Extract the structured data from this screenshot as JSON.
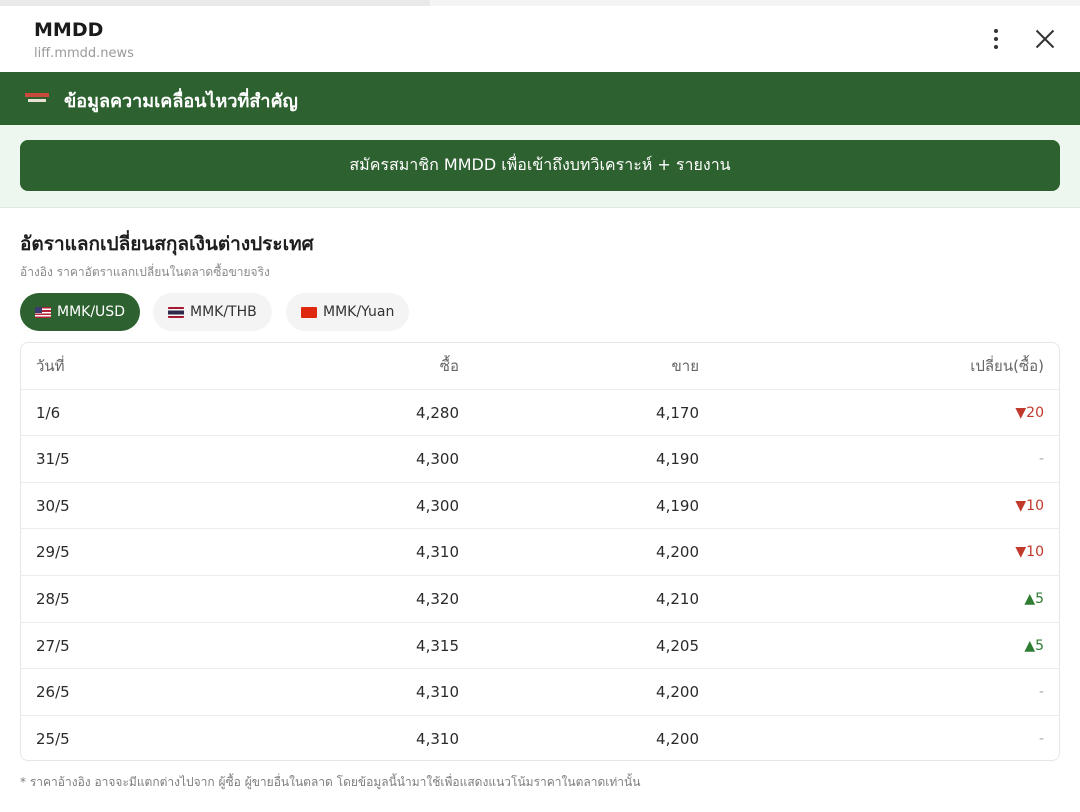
{
  "header": {
    "title": "MMDD",
    "url": "liff.mmdd.news"
  },
  "banner": {
    "title": "ข้อมูลความเคลื่อนไหวที่สำคัญ"
  },
  "promo": {
    "label": "สมัครสมาชิก MMDD เพื่อเข้าถึงบทวิเคราะห์ + รายงาน"
  },
  "section": {
    "title": "อัตราแลกเปลี่ยนสกุลเงินต่างประเทศ",
    "subtitle": "อ้างอิง ราคาอัตราแลกเปลี่ยนในตลาดซื้อขายจริง"
  },
  "tabs": [
    {
      "label": "MMK/USD",
      "flag": "us-flag-icon",
      "active": true
    },
    {
      "label": "MMK/THB",
      "flag": "thai-flag-icon",
      "active": false
    },
    {
      "label": "MMK/Yuan",
      "flag": "china-flag-icon",
      "active": false
    }
  ],
  "table": {
    "headers": {
      "date": "วันที่",
      "buy": "ซื้อ",
      "sell": "ขาย",
      "change": "เปลี่ยน(ซื้อ)"
    },
    "rows": [
      {
        "date": "1/6",
        "buy": "4,280",
        "sell": "4,170",
        "change": "▼20",
        "dir": "down"
      },
      {
        "date": "31/5",
        "buy": "4,300",
        "sell": "4,190",
        "change": "-",
        "dir": "flat"
      },
      {
        "date": "30/5",
        "buy": "4,300",
        "sell": "4,190",
        "change": "▼10",
        "dir": "down"
      },
      {
        "date": "29/5",
        "buy": "4,310",
        "sell": "4,200",
        "change": "▼10",
        "dir": "down"
      },
      {
        "date": "28/5",
        "buy": "4,320",
        "sell": "4,210",
        "change": "▲5",
        "dir": "up"
      },
      {
        "date": "27/5",
        "buy": "4,315",
        "sell": "4,205",
        "change": "▲5",
        "dir": "up"
      },
      {
        "date": "26/5",
        "buy": "4,310",
        "sell": "4,200",
        "change": "-",
        "dir": "flat"
      },
      {
        "date": "25/5",
        "buy": "4,310",
        "sell": "4,200",
        "change": "-",
        "dir": "flat"
      }
    ]
  },
  "footnote": "* ราคาอ้างอิง อาจจะมีแตกต่างไปจาก ผู้ซื้อ ผู้ขายอื่นในตลาด โดยข้อมูลนี้นำมาใช้เพื่อแสดงแนวโน้มราคาในตลาดเท่านั้น",
  "colors": {
    "brand_green": "#2d612f",
    "down": "#c0392b",
    "up": "#2e7d32"
  }
}
